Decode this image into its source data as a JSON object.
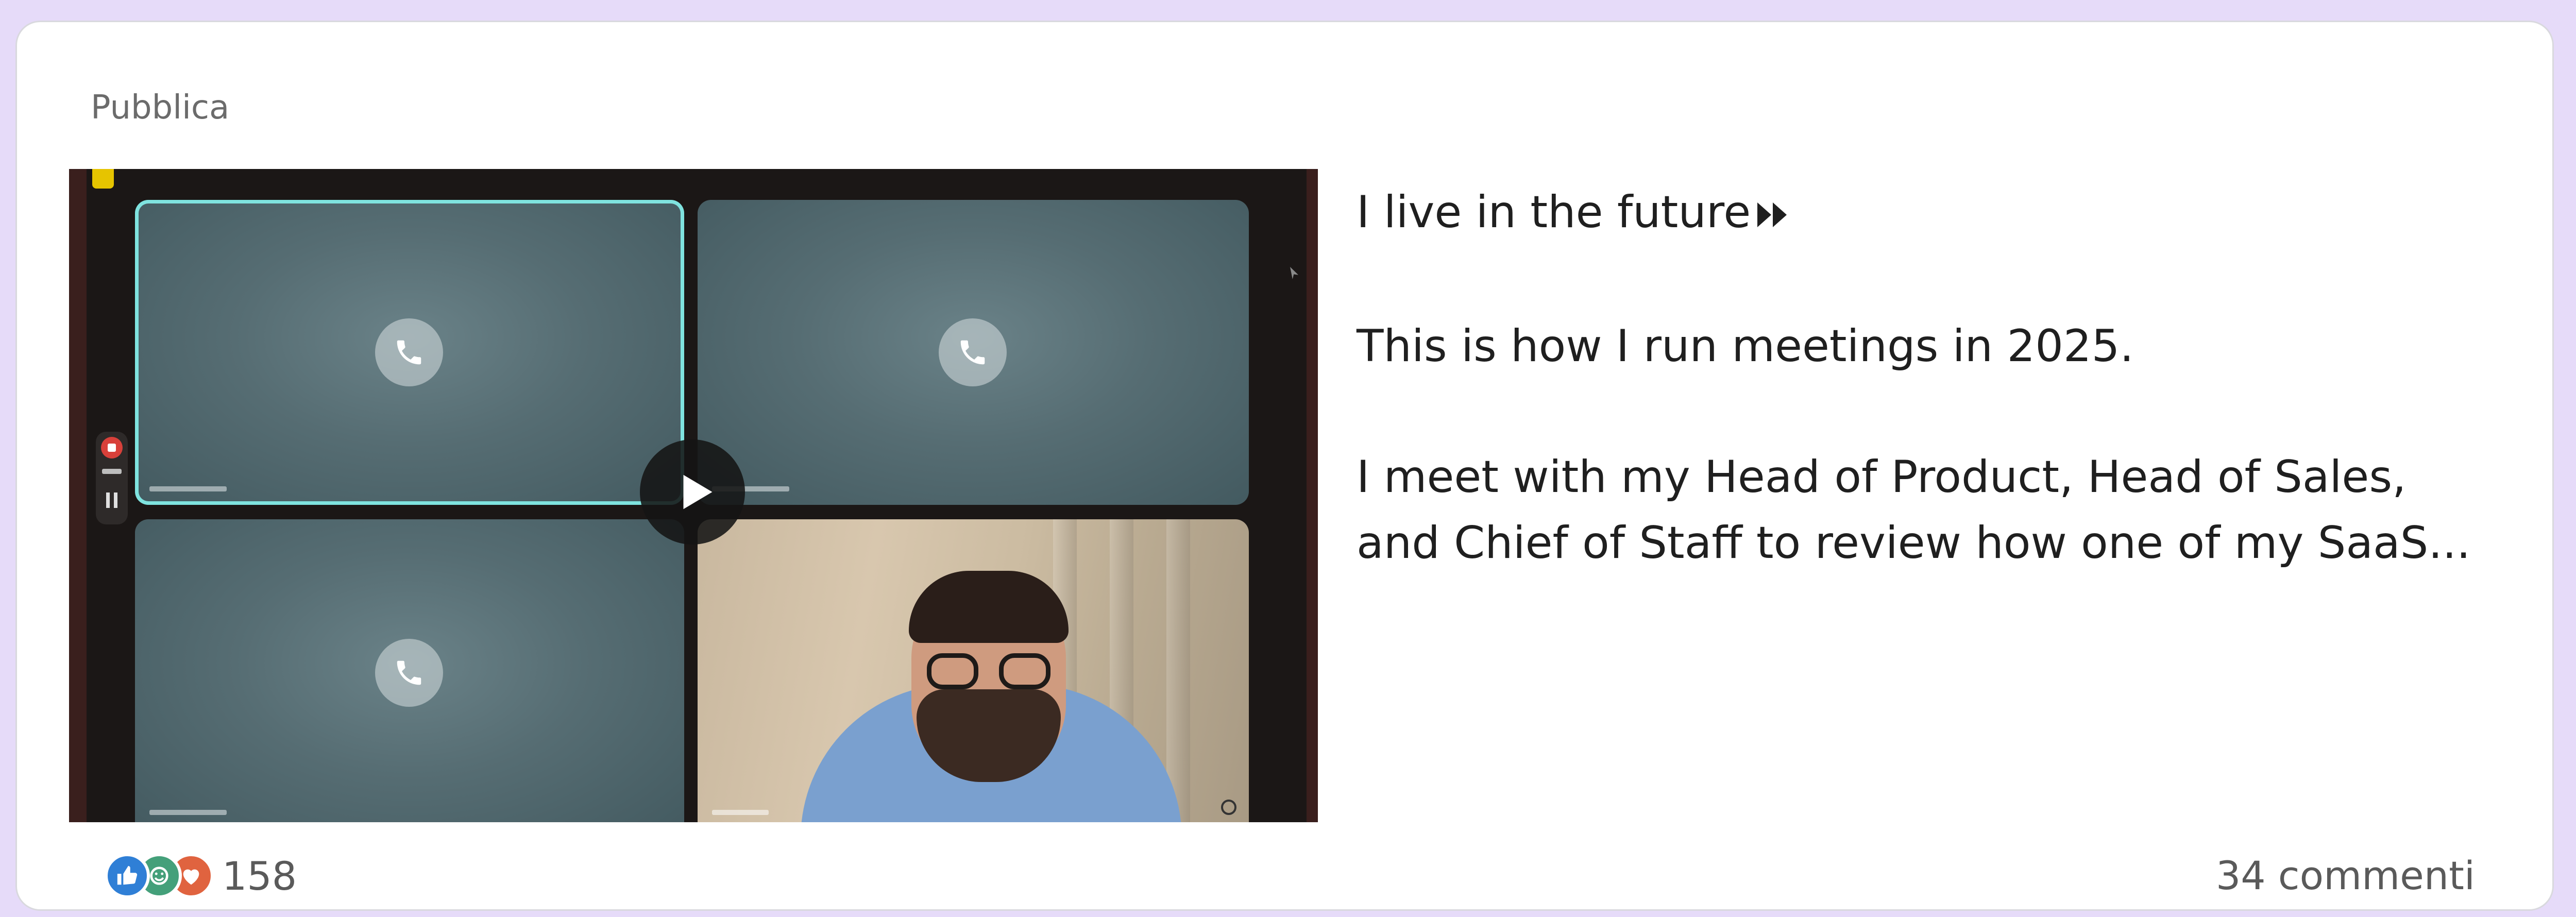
{
  "post": {
    "visibility": "Pubblica",
    "text_lines": [
      "I live in the future",
      "This is how I run meetings in 2025.",
      "I meet with my Head of Product, Head of Sales,",
      "and Chief of Staff to review how one of my SaaS..."
    ],
    "title_icon": "fast-forward-icon",
    "media": {
      "type": "video",
      "play_icon": "play-icon",
      "call_icon": "phone-icon"
    },
    "reactions": {
      "icons": [
        "like-icon",
        "celebrate-icon",
        "love-icon"
      ],
      "count": "158"
    },
    "comments": "34 commenti"
  },
  "colors": {
    "background": "#e6dbf9",
    "card": "#ffffff",
    "text": "#1f1f1f",
    "muted": "#5a5a5a",
    "like": "#2f7fd6",
    "celebrate": "#44a07a",
    "love": "#e0633f",
    "active_tile_border": "#7fe3df"
  }
}
